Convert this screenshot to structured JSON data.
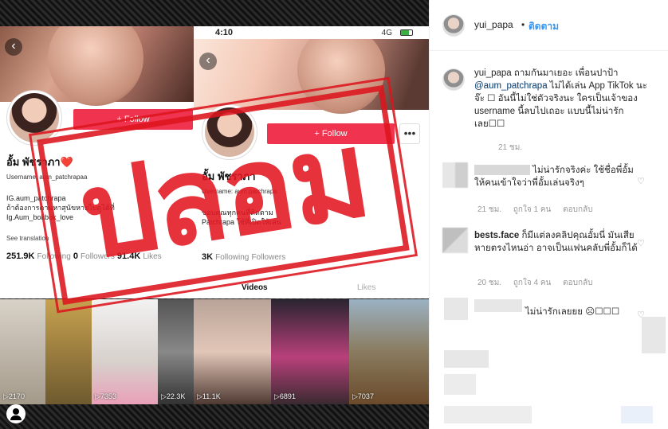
{
  "left_profile": {
    "name": "อั้ม พัชราภา❤️",
    "username": "Username: aum_patchrapaa",
    "follow_label": "+ Follow",
    "bio_lines": [
      "IG.aum_patchrapa",
      "ถ้าต้องการตามหาสุนัขหายไปดูได้ที่",
      "Ig.Aum_bokbok_love"
    ],
    "see_translation": "See translation",
    "stat_following": "251.9K",
    "stat_following_label": "Following",
    "stat_followers": "0",
    "stat_followers_label": "Followers",
    "stat_likes": "91.4K",
    "stat_likes_label": "Likes"
  },
  "right_profile": {
    "time": "4:10",
    "network": "4G",
    "battery_level": 0.7,
    "name": "อั้ม พัชราภา",
    "username": "Username: aum.patchrapa",
    "follow_label": "+ Follow",
    "more_label": "•••",
    "bio_lines": [
      "ขอบคุณทุกคนที่ติดตาม",
      "Patchrapa ใช้ที่เปิดให้เล่น"
    ],
    "stat_following": "3K",
    "stat_following_label": "Following",
    "stat_followers": "",
    "stat_followers_label": "Followers",
    "tab_videos": "Videos",
    "tab_likes": "Likes"
  },
  "stamp_text": "ปลอม",
  "video_counts": [
    "2170",
    "7353",
    "22.3K",
    "11.1K",
    "6891",
    "7037"
  ],
  "post": {
    "username": "yui_papa",
    "dot": "•",
    "follow_label": "ติดตาม",
    "caption_user": "yui_papa",
    "caption_pre": " ถามกันมาเยอะ เพื่อนปาป้า ",
    "caption_mention": "@aum_patchrapa",
    "caption_post": " ไม่ได้เล่น App TikTok นะจ๊ะ ☐ อันนี้ไม่ใช่ตัวจริงนะ ใครเป็นเจ้าของ username นี้ลบไปเถอะ แบบนี้ไม่น่ารักเลย☐☐",
    "caption_time": "21 ชม."
  },
  "comments": [
    {
      "user": "",
      "text": " ไม่น่ารักจริงค่ะ ใช้ชื่อพี่อั้มให้คนเข้าใจว่าพี่อั้มเล่นจริงๆ",
      "time": "21 ชม.",
      "likes": "ถูกใจ 1 คน",
      "reply": "ตอบกลับ"
    },
    {
      "user": "bests.face",
      "text": " ก็มีแต่ลงคลิปคุณอั้มนี่ มันเสียหายตรงไหนอ่า อาจเป็นแฟนคลับพี่อั้มก็ได้",
      "time": "20 ชม.",
      "likes": "ถูกใจ 4 คน",
      "reply": "ตอบกลับ"
    },
    {
      "user": "",
      "text": " ไม่น่ารักเลยยย ☹☐☐☐"
    }
  ],
  "icons": {
    "heart": "heart-icon",
    "back": "back-arrow-icon"
  },
  "colors": {
    "follow_red": "#f0344f",
    "stamp_red": "#e21620",
    "ig_blue": "#3897f0"
  }
}
